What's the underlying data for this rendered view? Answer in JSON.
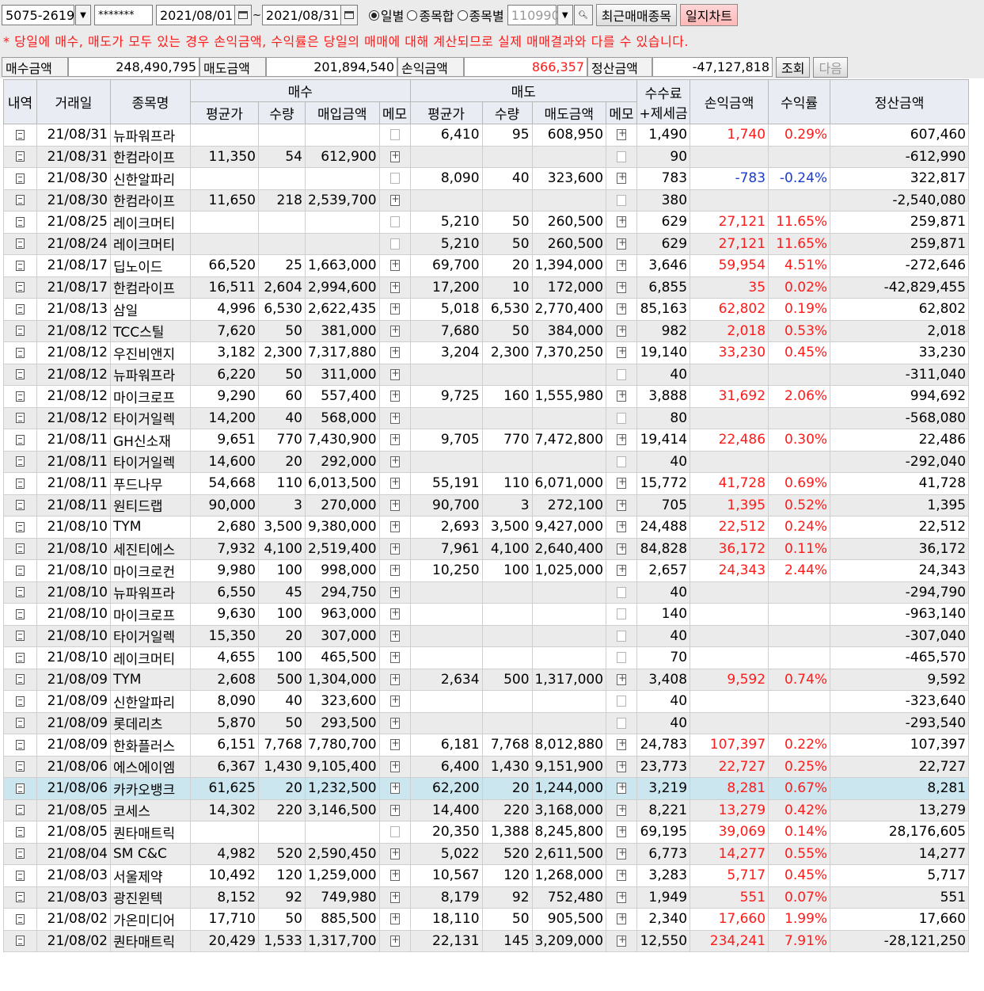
{
  "toolbar": {
    "account": "5075-2619",
    "password": "*******",
    "date_from": "2021/08/01",
    "date_sep": "~",
    "date_to": "2021/08/31",
    "radio_daily": "일별",
    "radio_stock_sum": "종목합",
    "radio_by_stock": "종목별",
    "stock_code_placeholder": "110990",
    "recent_trade_btn": "최근매매종목",
    "journal_chart_btn": "일지차트"
  },
  "notice": "* 당일에 매수, 매도가 모두 있는 경우 손익금액, 수익률은 당일의 매매에 대해 계산되므로 실제 매매결과와 다를 수 있습니다.",
  "summary": {
    "buy_label": "매수금액",
    "buy_value": "248,490,795",
    "sell_label": "매도금액",
    "sell_value": "201,894,540",
    "pl_label": "손익금액",
    "pl_value": "866,357",
    "settle_label": "정산금액",
    "settle_value": "-47,127,818",
    "query_btn": "조회",
    "next_btn": "다음"
  },
  "colors": {
    "profit": "#ff1a1a",
    "loss": "#1a3ccf",
    "selected_row": "#cce6f0",
    "header_bg": "#e9edf3"
  },
  "table": {
    "headers": {
      "detail": "내역",
      "date": "거래일",
      "name": "종목명",
      "buy_group": "매수",
      "sell_group": "매도",
      "fee_line1": "수수료",
      "fee_line2": "+제세금",
      "pl": "손익금액",
      "rate": "수익률",
      "settle": "정산금액",
      "avg_price": "평균가",
      "qty": "수량",
      "buy_amount": "매입금액",
      "memo": "메모",
      "sell_amount": "매도금액"
    },
    "rows": [
      {
        "date": "21/08/31",
        "name": "뉴파워프라",
        "b_avg": "",
        "b_qty": "",
        "b_amt": "",
        "b_memo": "empty",
        "s_avg": "6,410",
        "s_qty": "95",
        "s_amt": "608,950",
        "s_memo": "filled",
        "fee": "1,490",
        "pl": "1,740",
        "rate": "0.29%",
        "settle": "607,460",
        "sign": "pos"
      },
      {
        "date": "21/08/31",
        "name": "한컴라이프",
        "b_avg": "11,350",
        "b_qty": "54",
        "b_amt": "612,900",
        "b_memo": "filled",
        "s_avg": "",
        "s_qty": "",
        "s_amt": "",
        "s_memo": "empty",
        "fee": "90",
        "pl": "",
        "rate": "",
        "settle": "-612,990",
        "sign": ""
      },
      {
        "date": "21/08/30",
        "name": "신한알파리",
        "b_avg": "",
        "b_qty": "",
        "b_amt": "",
        "b_memo": "empty",
        "s_avg": "8,090",
        "s_qty": "40",
        "s_amt": "323,600",
        "s_memo": "filled",
        "fee": "783",
        "pl": "-783",
        "rate": "-0.24%",
        "settle": "322,817",
        "sign": "neg"
      },
      {
        "date": "21/08/30",
        "name": "한컴라이프",
        "b_avg": "11,650",
        "b_qty": "218",
        "b_amt": "2,539,700",
        "b_memo": "filled",
        "s_avg": "",
        "s_qty": "",
        "s_amt": "",
        "s_memo": "empty",
        "fee": "380",
        "pl": "",
        "rate": "",
        "settle": "-2,540,080",
        "sign": ""
      },
      {
        "date": "21/08/25",
        "name": "레이크머티",
        "b_avg": "",
        "b_qty": "",
        "b_amt": "",
        "b_memo": "empty",
        "s_avg": "5,210",
        "s_qty": "50",
        "s_amt": "260,500",
        "s_memo": "filled",
        "fee": "629",
        "pl": "27,121",
        "rate": "11.65%",
        "settle": "259,871",
        "sign": "pos"
      },
      {
        "date": "21/08/24",
        "name": "레이크머티",
        "b_avg": "",
        "b_qty": "",
        "b_amt": "",
        "b_memo": "empty",
        "s_avg": "5,210",
        "s_qty": "50",
        "s_amt": "260,500",
        "s_memo": "filled",
        "fee": "629",
        "pl": "27,121",
        "rate": "11.65%",
        "settle": "259,871",
        "sign": "pos"
      },
      {
        "date": "21/08/17",
        "name": "딥노이드",
        "b_avg": "66,520",
        "b_qty": "25",
        "b_amt": "1,663,000",
        "b_memo": "filled",
        "s_avg": "69,700",
        "s_qty": "20",
        "s_amt": "1,394,000",
        "s_memo": "filled",
        "fee": "3,646",
        "pl": "59,954",
        "rate": "4.51%",
        "settle": "-272,646",
        "sign": "pos"
      },
      {
        "date": "21/08/17",
        "name": "한컴라이프",
        "b_avg": "16,511",
        "b_qty": "2,604",
        "b_amt": "2,994,600",
        "b_memo": "filled",
        "s_avg": "17,200",
        "s_qty": "10",
        "s_amt": "172,000",
        "s_memo": "filled",
        "fee": "6,855",
        "pl": "35",
        "rate": "0.02%",
        "settle": "-42,829,455",
        "sign": "pos"
      },
      {
        "date": "21/08/13",
        "name": "삼일",
        "b_avg": "4,996",
        "b_qty": "6,530",
        "b_amt": "2,622,435",
        "b_memo": "filled",
        "s_avg": "5,018",
        "s_qty": "6,530",
        "s_amt": "2,770,400",
        "s_memo": "filled",
        "fee": "85,163",
        "pl": "62,802",
        "rate": "0.19%",
        "settle": "62,802",
        "sign": "pos"
      },
      {
        "date": "21/08/12",
        "name": "TCC스틸",
        "b_avg": "7,620",
        "b_qty": "50",
        "b_amt": "381,000",
        "b_memo": "filled",
        "s_avg": "7,680",
        "s_qty": "50",
        "s_amt": "384,000",
        "s_memo": "filled",
        "fee": "982",
        "pl": "2,018",
        "rate": "0.53%",
        "settle": "2,018",
        "sign": "pos"
      },
      {
        "date": "21/08/12",
        "name": "우진비앤지",
        "b_avg": "3,182",
        "b_qty": "2,300",
        "b_amt": "7,317,880",
        "b_memo": "filled",
        "s_avg": "3,204",
        "s_qty": "2,300",
        "s_amt": "7,370,250",
        "s_memo": "filled",
        "fee": "19,140",
        "pl": "33,230",
        "rate": "0.45%",
        "settle": "33,230",
        "sign": "pos"
      },
      {
        "date": "21/08/12",
        "name": "뉴파워프라",
        "b_avg": "6,220",
        "b_qty": "50",
        "b_amt": "311,000",
        "b_memo": "filled",
        "s_avg": "",
        "s_qty": "",
        "s_amt": "",
        "s_memo": "empty",
        "fee": "40",
        "pl": "",
        "rate": "",
        "settle": "-311,040",
        "sign": ""
      },
      {
        "date": "21/08/12",
        "name": "마이크로프",
        "b_avg": "9,290",
        "b_qty": "60",
        "b_amt": "557,400",
        "b_memo": "filled",
        "s_avg": "9,725",
        "s_qty": "160",
        "s_amt": "1,555,980",
        "s_memo": "filled",
        "fee": "3,888",
        "pl": "31,692",
        "rate": "2.06%",
        "settle": "994,692",
        "sign": "pos"
      },
      {
        "date": "21/08/12",
        "name": "타이거일렉",
        "b_avg": "14,200",
        "b_qty": "40",
        "b_amt": "568,000",
        "b_memo": "filled",
        "s_avg": "",
        "s_qty": "",
        "s_amt": "",
        "s_memo": "empty",
        "fee": "80",
        "pl": "",
        "rate": "",
        "settle": "-568,080",
        "sign": ""
      },
      {
        "date": "21/08/11",
        "name": "GH신소재",
        "b_avg": "9,651",
        "b_qty": "770",
        "b_amt": "7,430,900",
        "b_memo": "filled",
        "s_avg": "9,705",
        "s_qty": "770",
        "s_amt": "7,472,800",
        "s_memo": "filled",
        "fee": "19,414",
        "pl": "22,486",
        "rate": "0.30%",
        "settle": "22,486",
        "sign": "pos"
      },
      {
        "date": "21/08/11",
        "name": "타이거일렉",
        "b_avg": "14,600",
        "b_qty": "20",
        "b_amt": "292,000",
        "b_memo": "filled",
        "s_avg": "",
        "s_qty": "",
        "s_amt": "",
        "s_memo": "empty",
        "fee": "40",
        "pl": "",
        "rate": "",
        "settle": "-292,040",
        "sign": ""
      },
      {
        "date": "21/08/11",
        "name": "푸드나무",
        "b_avg": "54,668",
        "b_qty": "110",
        "b_amt": "6,013,500",
        "b_memo": "filled",
        "s_avg": "55,191",
        "s_qty": "110",
        "s_amt": "6,071,000",
        "s_memo": "filled",
        "fee": "15,772",
        "pl": "41,728",
        "rate": "0.69%",
        "settle": "41,728",
        "sign": "pos"
      },
      {
        "date": "21/08/11",
        "name": "원티드랩",
        "b_avg": "90,000",
        "b_qty": "3",
        "b_amt": "270,000",
        "b_memo": "filled",
        "s_avg": "90,700",
        "s_qty": "3",
        "s_amt": "272,100",
        "s_memo": "filled",
        "fee": "705",
        "pl": "1,395",
        "rate": "0.52%",
        "settle": "1,395",
        "sign": "pos"
      },
      {
        "date": "21/08/10",
        "name": "TYM",
        "b_avg": "2,680",
        "b_qty": "3,500",
        "b_amt": "9,380,000",
        "b_memo": "filled",
        "s_avg": "2,693",
        "s_qty": "3,500",
        "s_amt": "9,427,000",
        "s_memo": "filled",
        "fee": "24,488",
        "pl": "22,512",
        "rate": "0.24%",
        "settle": "22,512",
        "sign": "pos"
      },
      {
        "date": "21/08/10",
        "name": "세진티에스",
        "b_avg": "7,932",
        "b_qty": "4,100",
        "b_amt": "2,519,400",
        "b_memo": "filled",
        "s_avg": "7,961",
        "s_qty": "4,100",
        "s_amt": "2,640,400",
        "s_memo": "filled",
        "fee": "84,828",
        "pl": "36,172",
        "rate": "0.11%",
        "settle": "36,172",
        "sign": "pos"
      },
      {
        "date": "21/08/10",
        "name": "마이크로컨",
        "b_avg": "9,980",
        "b_qty": "100",
        "b_amt": "998,000",
        "b_memo": "filled",
        "s_avg": "10,250",
        "s_qty": "100",
        "s_amt": "1,025,000",
        "s_memo": "filled",
        "fee": "2,657",
        "pl": "24,343",
        "rate": "2.44%",
        "settle": "24,343",
        "sign": "pos"
      },
      {
        "date": "21/08/10",
        "name": "뉴파워프라",
        "b_avg": "6,550",
        "b_qty": "45",
        "b_amt": "294,750",
        "b_memo": "filled",
        "s_avg": "",
        "s_qty": "",
        "s_amt": "",
        "s_memo": "empty",
        "fee": "40",
        "pl": "",
        "rate": "",
        "settle": "-294,790",
        "sign": ""
      },
      {
        "date": "21/08/10",
        "name": "마이크로프",
        "b_avg": "9,630",
        "b_qty": "100",
        "b_amt": "963,000",
        "b_memo": "filled",
        "s_avg": "",
        "s_qty": "",
        "s_amt": "",
        "s_memo": "empty",
        "fee": "140",
        "pl": "",
        "rate": "",
        "settle": "-963,140",
        "sign": ""
      },
      {
        "date": "21/08/10",
        "name": "타이거일렉",
        "b_avg": "15,350",
        "b_qty": "20",
        "b_amt": "307,000",
        "b_memo": "filled",
        "s_avg": "",
        "s_qty": "",
        "s_amt": "",
        "s_memo": "empty",
        "fee": "40",
        "pl": "",
        "rate": "",
        "settle": "-307,040",
        "sign": ""
      },
      {
        "date": "21/08/10",
        "name": "레이크머티",
        "b_avg": "4,655",
        "b_qty": "100",
        "b_amt": "465,500",
        "b_memo": "filled",
        "s_avg": "",
        "s_qty": "",
        "s_amt": "",
        "s_memo": "empty",
        "fee": "70",
        "pl": "",
        "rate": "",
        "settle": "-465,570",
        "sign": ""
      },
      {
        "date": "21/08/09",
        "name": "TYM",
        "b_avg": "2,608",
        "b_qty": "500",
        "b_amt": "1,304,000",
        "b_memo": "filled",
        "s_avg": "2,634",
        "s_qty": "500",
        "s_amt": "1,317,000",
        "s_memo": "filled",
        "fee": "3,408",
        "pl": "9,592",
        "rate": "0.74%",
        "settle": "9,592",
        "sign": "pos"
      },
      {
        "date": "21/08/09",
        "name": "신한알파리",
        "b_avg": "8,090",
        "b_qty": "40",
        "b_amt": "323,600",
        "b_memo": "filled",
        "s_avg": "",
        "s_qty": "",
        "s_amt": "",
        "s_memo": "empty",
        "fee": "40",
        "pl": "",
        "rate": "",
        "settle": "-323,640",
        "sign": ""
      },
      {
        "date": "21/08/09",
        "name": "롯데리츠",
        "b_avg": "5,870",
        "b_qty": "50",
        "b_amt": "293,500",
        "b_memo": "filled",
        "s_avg": "",
        "s_qty": "",
        "s_amt": "",
        "s_memo": "empty",
        "fee": "40",
        "pl": "",
        "rate": "",
        "settle": "-293,540",
        "sign": ""
      },
      {
        "date": "21/08/09",
        "name": "한화플러스",
        "b_avg": "6,151",
        "b_qty": "7,768",
        "b_amt": "7,780,700",
        "b_memo": "filled",
        "s_avg": "6,181",
        "s_qty": "7,768",
        "s_amt": "8,012,880",
        "s_memo": "filled",
        "fee": "24,783",
        "pl": "107,397",
        "rate": "0.22%",
        "settle": "107,397",
        "sign": "pos"
      },
      {
        "date": "21/08/06",
        "name": "에스에이엠",
        "b_avg": "6,367",
        "b_qty": "1,430",
        "b_amt": "9,105,400",
        "b_memo": "filled",
        "s_avg": "6,400",
        "s_qty": "1,430",
        "s_amt": "9,151,900",
        "s_memo": "filled",
        "fee": "23,773",
        "pl": "22,727",
        "rate": "0.25%",
        "settle": "22,727",
        "sign": "pos"
      },
      {
        "date": "21/08/06",
        "name": "카카오뱅크",
        "b_avg": "61,625",
        "b_qty": "20",
        "b_amt": "1,232,500",
        "b_memo": "filled",
        "s_avg": "62,200",
        "s_qty": "20",
        "s_amt": "1,244,000",
        "s_memo": "filled",
        "fee": "3,219",
        "pl": "8,281",
        "rate": "0.67%",
        "settle": "8,281",
        "sign": "pos",
        "selected": true
      },
      {
        "date": "21/08/05",
        "name": "코세스",
        "b_avg": "14,302",
        "b_qty": "220",
        "b_amt": "3,146,500",
        "b_memo": "filled",
        "s_avg": "14,400",
        "s_qty": "220",
        "s_amt": "3,168,000",
        "s_memo": "filled",
        "fee": "8,221",
        "pl": "13,279",
        "rate": "0.42%",
        "settle": "13,279",
        "sign": "pos"
      },
      {
        "date": "21/08/05",
        "name": "퀀타매트릭",
        "b_avg": "",
        "b_qty": "",
        "b_amt": "",
        "b_memo": "empty",
        "s_avg": "20,350",
        "s_qty": "1,388",
        "s_amt": "8,245,800",
        "s_memo": "filled",
        "fee": "69,195",
        "pl": "39,069",
        "rate": "0.14%",
        "settle": "28,176,605",
        "sign": "pos"
      },
      {
        "date": "21/08/04",
        "name": "SM C&C",
        "b_avg": "4,982",
        "b_qty": "520",
        "b_amt": "2,590,450",
        "b_memo": "filled",
        "s_avg": "5,022",
        "s_qty": "520",
        "s_amt": "2,611,500",
        "s_memo": "filled",
        "fee": "6,773",
        "pl": "14,277",
        "rate": "0.55%",
        "settle": "14,277",
        "sign": "pos"
      },
      {
        "date": "21/08/03",
        "name": "서울제약",
        "b_avg": "10,492",
        "b_qty": "120",
        "b_amt": "1,259,000",
        "b_memo": "filled",
        "s_avg": "10,567",
        "s_qty": "120",
        "s_amt": "1,268,000",
        "s_memo": "filled",
        "fee": "3,283",
        "pl": "5,717",
        "rate": "0.45%",
        "settle": "5,717",
        "sign": "pos"
      },
      {
        "date": "21/08/03",
        "name": "광진윈텍",
        "b_avg": "8,152",
        "b_qty": "92",
        "b_amt": "749,980",
        "b_memo": "filled",
        "s_avg": "8,179",
        "s_qty": "92",
        "s_amt": "752,480",
        "s_memo": "filled",
        "fee": "1,949",
        "pl": "551",
        "rate": "0.07%",
        "settle": "551",
        "sign": "pos"
      },
      {
        "date": "21/08/02",
        "name": "가온미디어",
        "b_avg": "17,710",
        "b_qty": "50",
        "b_amt": "885,500",
        "b_memo": "filled",
        "s_avg": "18,110",
        "s_qty": "50",
        "s_amt": "905,500",
        "s_memo": "filled",
        "fee": "2,340",
        "pl": "17,660",
        "rate": "1.99%",
        "settle": "17,660",
        "sign": "pos"
      },
      {
        "date": "21/08/02",
        "name": "퀀타매트릭",
        "b_avg": "20,429",
        "b_qty": "1,533",
        "b_amt": "1,317,700",
        "b_memo": "filled",
        "s_avg": "22,131",
        "s_qty": "145",
        "s_amt": "3,209,000",
        "s_memo": "filled",
        "fee": "12,550",
        "pl": "234,241",
        "rate": "7.91%",
        "settle": "-28,121,250",
        "sign": "pos"
      }
    ]
  }
}
